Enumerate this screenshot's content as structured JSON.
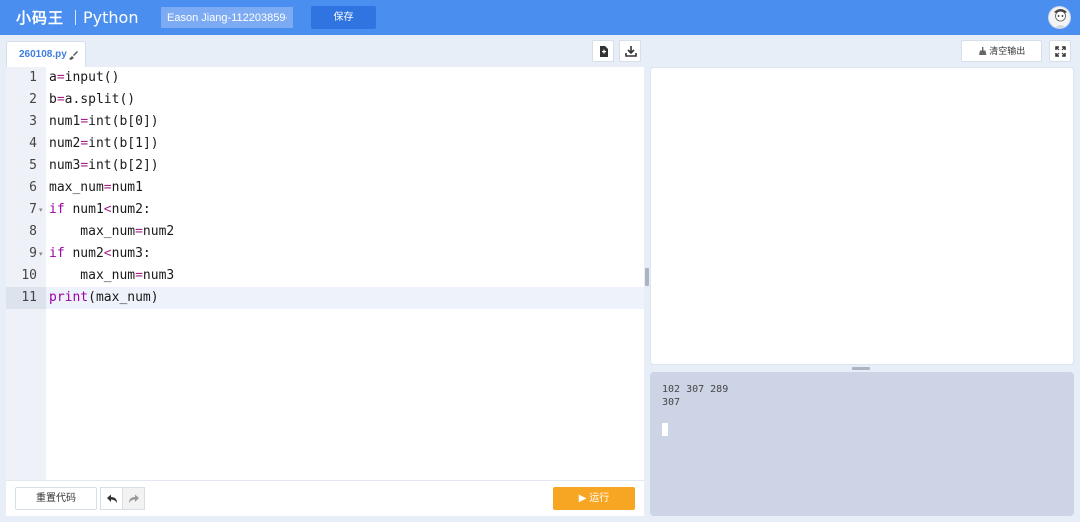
{
  "header": {
    "logo": "小码王",
    "product": "Python",
    "project_title": "Eason Jiang-112203859-",
    "save_label": "保存"
  },
  "editor": {
    "tab_label": "260108.py",
    "lines": [
      {
        "no": "1",
        "text": "a=input()"
      },
      {
        "no": "2",
        "text": "b=a.split()"
      },
      {
        "no": "3",
        "text": "num1=int(b[0])"
      },
      {
        "no": "4",
        "text": "num2=int(b[1])"
      },
      {
        "no": "5",
        "text": "num3=int(b[2])"
      },
      {
        "no": "6",
        "text": "max_num=num1"
      },
      {
        "no": "7",
        "text": "if num1<num2:"
      },
      {
        "no": "8",
        "text": "    max_num=num2"
      },
      {
        "no": "9",
        "text": "if num2<num3:"
      },
      {
        "no": "10",
        "text": "    max_num=num3"
      },
      {
        "no": "11",
        "text": "print(max_num)"
      }
    ],
    "active_line": "11"
  },
  "bottom": {
    "reset_label": "重置代码",
    "run_label": "▶ 运行"
  },
  "output": {
    "clear_label": "清空输出",
    "console_lines": [
      "102 307 289",
      "307"
    ]
  },
  "colors": {
    "header_bg": "#4a8eef",
    "run_button": "#f7a623",
    "keyword": "#9d00a8",
    "console_bg": "#ccd4e6"
  }
}
